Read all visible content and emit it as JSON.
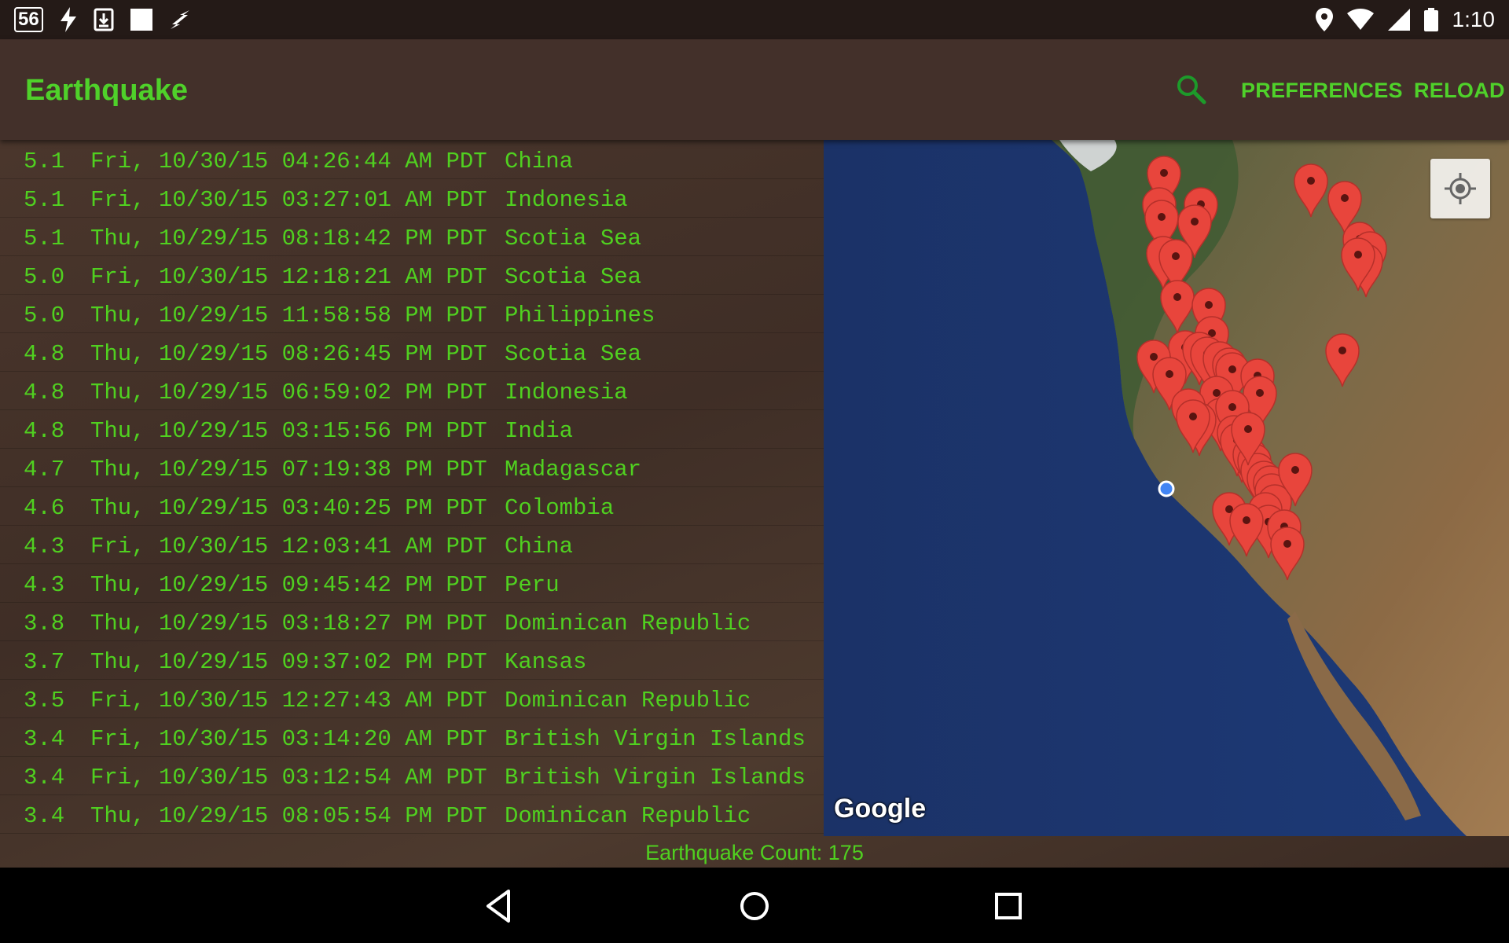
{
  "status_bar": {
    "badge": "56",
    "time": "1:10",
    "icons": [
      "flash-icon",
      "download-icon",
      "white-square-icon",
      "lightning-icon",
      "location-icon",
      "wifi-icon",
      "signal-icon",
      "battery-icon"
    ]
  },
  "app_bar": {
    "title": "Earthquake",
    "search_icon": "search-icon",
    "preferences_label": "PREFERENCES",
    "reload_label": "RELOAD"
  },
  "colors": {
    "accent": "#4fd12a",
    "app_bar_bg": "#43302a",
    "status_bar_bg": "#241a17",
    "marker": "#e8453c"
  },
  "quakes": [
    {
      "mag": "5.1",
      "date": "Fri, 10/30/15 04:26:44 AM PDT",
      "place": "China"
    },
    {
      "mag": "5.1",
      "date": "Fri, 10/30/15 03:27:01 AM PDT",
      "place": "Indonesia"
    },
    {
      "mag": "5.1",
      "date": "Thu, 10/29/15 08:18:42 PM PDT",
      "place": "Scotia Sea"
    },
    {
      "mag": "5.0",
      "date": "Fri, 10/30/15 12:18:21 AM PDT",
      "place": "Scotia Sea"
    },
    {
      "mag": "5.0",
      "date": "Thu, 10/29/15 11:58:58 PM PDT",
      "place": "Philippines"
    },
    {
      "mag": "4.8",
      "date": "Thu, 10/29/15 08:26:45 PM PDT",
      "place": "Scotia Sea"
    },
    {
      "mag": "4.8",
      "date": "Thu, 10/29/15 06:59:02 PM PDT",
      "place": "Indonesia"
    },
    {
      "mag": "4.8",
      "date": "Thu, 10/29/15 03:15:56 PM PDT",
      "place": "India"
    },
    {
      "mag": "4.7",
      "date": "Thu, 10/29/15 07:19:38 PM PDT",
      "place": "Madagascar"
    },
    {
      "mag": "4.6",
      "date": "Thu, 10/29/15 03:40:25 PM PDT",
      "place": "Colombia"
    },
    {
      "mag": "4.3",
      "date": "Fri, 10/30/15 12:03:41 AM PDT",
      "place": "China"
    },
    {
      "mag": "4.3",
      "date": "Thu, 10/29/15 09:45:42 PM PDT",
      "place": "Peru"
    },
    {
      "mag": "3.8",
      "date": "Thu, 10/29/15 03:18:27 PM PDT",
      "place": "Dominican Republic"
    },
    {
      "mag": "3.7",
      "date": "Thu, 10/29/15 09:37:02 PM PDT",
      "place": "Kansas"
    },
    {
      "mag": "3.5",
      "date": "Fri, 10/30/15 12:27:43 AM PDT",
      "place": "Dominican Republic"
    },
    {
      "mag": "3.4",
      "date": "Fri, 10/30/15 03:14:20 AM PDT",
      "place": "British Virgin Islands"
    },
    {
      "mag": "3.4",
      "date": "Fri, 10/30/15 03:12:54 AM PDT",
      "place": "British Virgin Islands"
    },
    {
      "mag": "3.4",
      "date": "Thu, 10/29/15 08:05:54 PM PDT",
      "place": "Dominican Republic"
    }
  ],
  "map": {
    "logo_text": "Google",
    "my_location_icon": "my-location-icon",
    "marker_icon": "map-marker-icon"
  },
  "footer": {
    "count_text": "Earthquake Count: 175"
  },
  "nav_bar": {
    "icons": [
      "back-icon",
      "home-icon",
      "recents-icon"
    ]
  }
}
